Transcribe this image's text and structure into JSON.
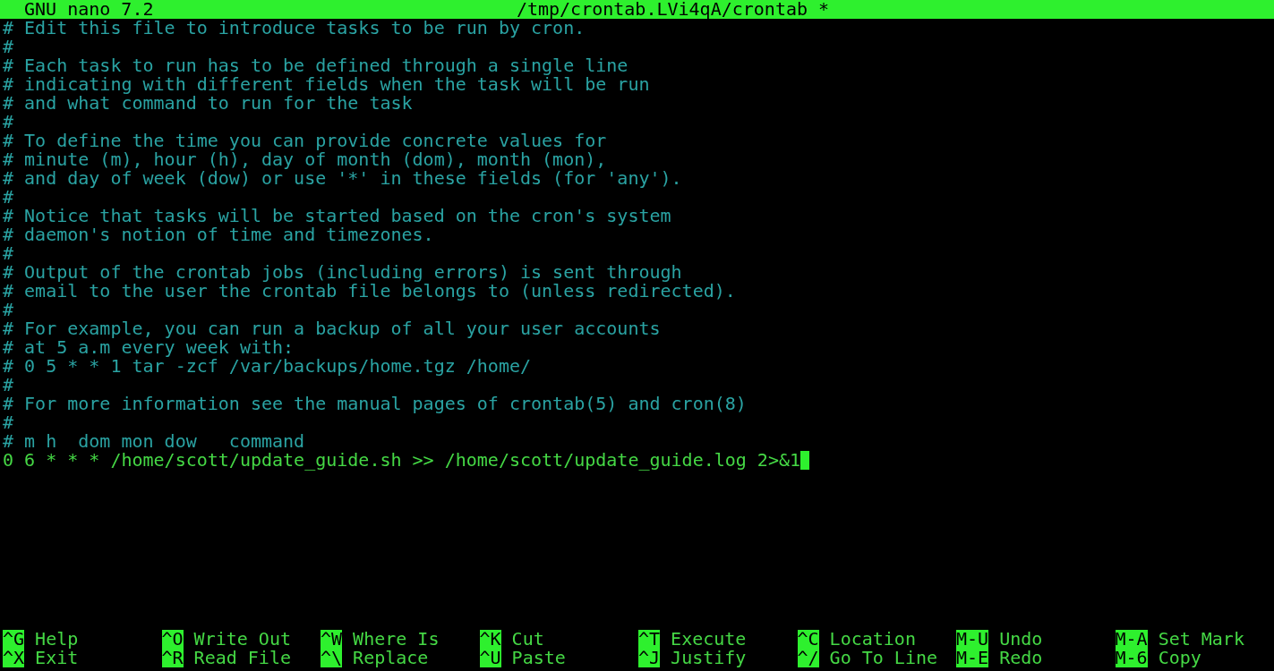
{
  "title_bar": {
    "app": "GNU nano 7.2",
    "file": "/tmp/crontab.LVi4qA/crontab *"
  },
  "lines": [
    {
      "kind": "comment",
      "text": "# Edit this file to introduce tasks to be run by cron.",
      "cursor": false
    },
    {
      "kind": "comment",
      "text": "#",
      "cursor": false
    },
    {
      "kind": "comment",
      "text": "# Each task to run has to be defined through a single line",
      "cursor": false
    },
    {
      "kind": "comment",
      "text": "# indicating with different fields when the task will be run",
      "cursor": false
    },
    {
      "kind": "comment",
      "text": "# and what command to run for the task",
      "cursor": false
    },
    {
      "kind": "comment",
      "text": "#",
      "cursor": false
    },
    {
      "kind": "comment",
      "text": "# To define the time you can provide concrete values for",
      "cursor": false
    },
    {
      "kind": "comment",
      "text": "# minute (m), hour (h), day of month (dom), month (mon),",
      "cursor": false
    },
    {
      "kind": "comment",
      "text": "# and day of week (dow) or use '*' in these fields (for 'any').",
      "cursor": false
    },
    {
      "kind": "comment",
      "text": "#",
      "cursor": false
    },
    {
      "kind": "comment",
      "text": "# Notice that tasks will be started based on the cron's system",
      "cursor": false
    },
    {
      "kind": "comment",
      "text": "# daemon's notion of time and timezones.",
      "cursor": false
    },
    {
      "kind": "comment",
      "text": "#",
      "cursor": false
    },
    {
      "kind": "comment",
      "text": "# Output of the crontab jobs (including errors) is sent through",
      "cursor": false
    },
    {
      "kind": "comment",
      "text": "# email to the user the crontab file belongs to (unless redirected).",
      "cursor": false
    },
    {
      "kind": "comment",
      "text": "#",
      "cursor": false
    },
    {
      "kind": "comment",
      "text": "# For example, you can run a backup of all your user accounts",
      "cursor": false
    },
    {
      "kind": "comment",
      "text": "# at 5 a.m every week with:",
      "cursor": false
    },
    {
      "kind": "comment",
      "text": "# 0 5 * * 1 tar -zcf /var/backups/home.tgz /home/",
      "cursor": false
    },
    {
      "kind": "comment",
      "text": "#",
      "cursor": false
    },
    {
      "kind": "comment",
      "text": "# For more information see the manual pages of crontab(5) and cron(8)",
      "cursor": false
    },
    {
      "kind": "comment",
      "text": "#",
      "cursor": false
    },
    {
      "kind": "comment",
      "text": "# m h  dom mon dow   command",
      "cursor": false
    },
    {
      "kind": "command",
      "text": "0 6 * * * /home/scott/update_guide.sh >> /home/scott/update_guide.log 2>&1",
      "cursor": true
    }
  ],
  "shortcuts": [
    [
      {
        "key": "^G",
        "label": "Help"
      },
      {
        "key": "^O",
        "label": "Write Out"
      },
      {
        "key": "^W",
        "label": "Where Is"
      },
      {
        "key": "^K",
        "label": "Cut"
      },
      {
        "key": "^T",
        "label": "Execute"
      },
      {
        "key": "^C",
        "label": "Location"
      },
      {
        "key": "M-U",
        "label": "Undo"
      },
      {
        "key": "M-A",
        "label": "Set Mark"
      }
    ],
    [
      {
        "key": "^X",
        "label": "Exit"
      },
      {
        "key": "^R",
        "label": "Read File"
      },
      {
        "key": "^\\",
        "label": "Replace"
      },
      {
        "key": "^U",
        "label": "Paste"
      },
      {
        "key": "^J",
        "label": "Justify"
      },
      {
        "key": "^/",
        "label": "Go To Line"
      },
      {
        "key": "M-E",
        "label": "Redo"
      },
      {
        "key": "M-6",
        "label": "Copy"
      }
    ]
  ]
}
